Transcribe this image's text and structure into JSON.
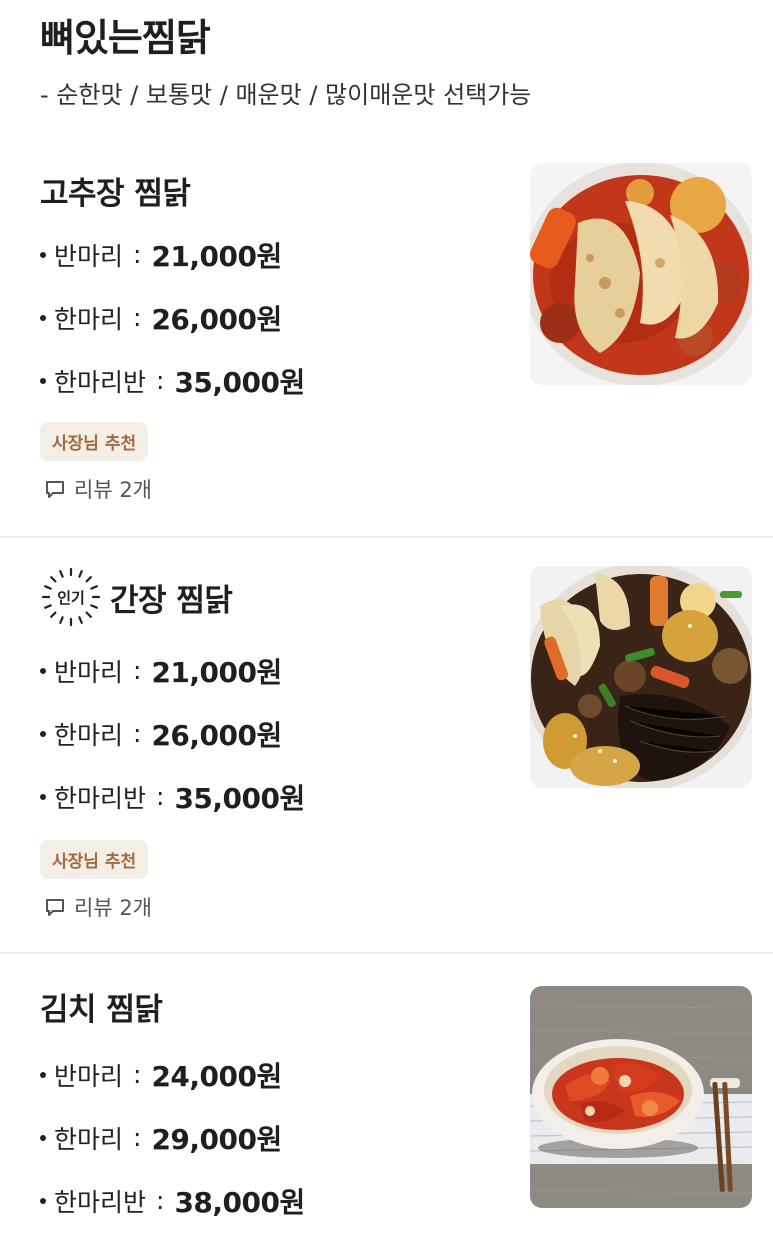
{
  "section": {
    "title": "뼈있는찜닭",
    "description": "- 순한맛 / 보통맛 / 매운맛 / 많이매운맛 선택가능"
  },
  "items": [
    {
      "name": "고추장 찜닭",
      "prices": [
        {
          "label": "반마리",
          "price": "21,000원"
        },
        {
          "label": "한마리",
          "price": "26,000원"
        },
        {
          "label": "한마리반",
          "price": "35,000원"
        }
      ],
      "badge": "사장님 추천",
      "review_label": "리뷰 2개"
    },
    {
      "name": "간장 찜닭",
      "popular_label": "인기",
      "prices": [
        {
          "label": "반마리",
          "price": "21,000원"
        },
        {
          "label": "한마리",
          "price": "26,000원"
        },
        {
          "label": "한마리반",
          "price": "35,000원"
        }
      ],
      "badge": "사장님 추천",
      "review_label": "리뷰 2개"
    },
    {
      "name": "김치 찜닭",
      "prices": [
        {
          "label": "반마리",
          "price": "24,000원"
        },
        {
          "label": "한마리",
          "price": "29,000원"
        },
        {
          "label": "한마리반",
          "price": "38,000원"
        }
      ]
    }
  ],
  "separator": ":",
  "icons": {
    "review": "speech-bubble-icon",
    "popular": "sunburst-badge-icon"
  },
  "colors": {
    "badge_bg": "#f3eee6",
    "badge_text": "#a26a3d",
    "divider": "#eeeeee"
  }
}
